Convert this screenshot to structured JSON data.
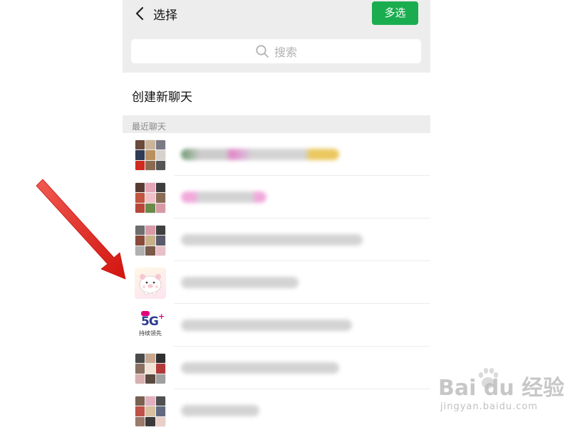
{
  "header": {
    "title": "选择",
    "multi_select_label": "多选",
    "accent_color": "#1aad4f"
  },
  "search": {
    "placeholder": "搜索",
    "icon": "search-icon"
  },
  "create_chat": {
    "label": "创建新聊天"
  },
  "recent": {
    "section_label": "最近聊天",
    "items": [
      {
        "avatar": "group-grid",
        "name_blurred": true
      },
      {
        "avatar": "group-grid",
        "name_blurred": true
      },
      {
        "avatar": "group-grid",
        "name_blurred": true
      },
      {
        "avatar": "pig-sticker",
        "name_blurred": true
      },
      {
        "avatar": "5g-logo",
        "avatar_text_main": "5G",
        "avatar_text_sub": "持续领先",
        "name_blurred": true
      },
      {
        "avatar": "group-grid",
        "name_blurred": true
      },
      {
        "avatar": "group-grid",
        "name_blurred": true
      }
    ]
  },
  "overlay": {
    "arrow_color": "#e0201c"
  },
  "watermark": {
    "logo_text": "Bai du 经验",
    "url": "jingyan.baidu.com"
  }
}
